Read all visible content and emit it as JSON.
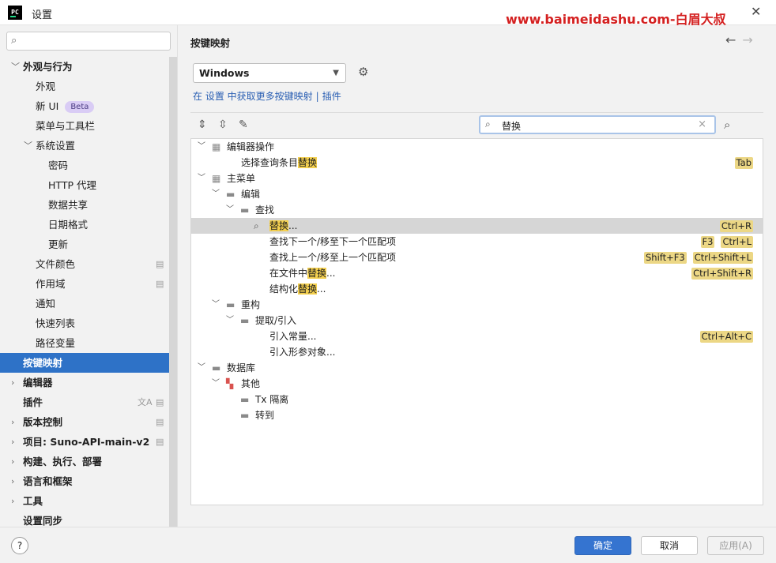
{
  "window": {
    "app_icon_text": "PC",
    "title": "设置",
    "watermark": "www.baimeidashu.com-白眉大叔"
  },
  "sidebar": {
    "search_placeholder": "",
    "items": [
      {
        "label": "外观与行为",
        "bold": true,
        "expanded": true
      },
      {
        "label": "外观"
      },
      {
        "label": "新 UI",
        "badge": "Beta"
      },
      {
        "label": "菜单与工具栏"
      },
      {
        "label": "系统设置",
        "expanded": true
      },
      {
        "label": "密码"
      },
      {
        "label": "HTTP 代理"
      },
      {
        "label": "数据共享"
      },
      {
        "label": "日期格式"
      },
      {
        "label": "更新"
      },
      {
        "label": "文件颜色"
      },
      {
        "label": "作用域"
      },
      {
        "label": "通知"
      },
      {
        "label": "快速列表"
      },
      {
        "label": "路径变量"
      },
      {
        "label": "按键映射",
        "bold": true,
        "selected": true
      },
      {
        "label": "编辑器",
        "bold": true
      },
      {
        "label": "插件",
        "bold": true
      },
      {
        "label": "版本控制",
        "bold": true
      },
      {
        "label": "项目: Suno-API-main-v2",
        "bold": true
      },
      {
        "label": "构建、执行、部署",
        "bold": true
      },
      {
        "label": "语言和框架",
        "bold": true
      },
      {
        "label": "工具",
        "bold": true
      },
      {
        "label": "设置同步",
        "bold": true
      }
    ]
  },
  "main": {
    "title": "按键映射",
    "keymap_value": "Windows",
    "links": {
      "prefix": "在 设置 中获取更多按键映射",
      "sep": "|",
      "plugins": "插件"
    },
    "filter_value": "替换",
    "tree": [
      {
        "label": "编辑器操作"
      },
      {
        "label_pre": "选择查询条目",
        "label_hl": "替换",
        "label_post": "",
        "shortcuts": [
          "Tab"
        ]
      },
      {
        "label": "主菜单"
      },
      {
        "label": "编辑"
      },
      {
        "label": "查找"
      },
      {
        "label_pre": "",
        "label_hl": "替换",
        "label_post": "...",
        "shortcuts": [
          "Ctrl+R"
        ]
      },
      {
        "label": "查找下一个/移至下一个匹配项",
        "shortcuts": [
          "F3",
          "Ctrl+L"
        ]
      },
      {
        "label": "查找上一个/移至上一个匹配项",
        "shortcuts": [
          "Shift+F3",
          "Ctrl+Shift+L"
        ]
      },
      {
        "label_pre": "在文件中",
        "label_hl": "替换",
        "label_post": "...",
        "shortcuts": [
          "Ctrl+Shift+R"
        ]
      },
      {
        "label_pre": "结构化",
        "label_hl": "替换",
        "label_post": "..."
      },
      {
        "label": "重构"
      },
      {
        "label": "提取/引入"
      },
      {
        "label": "引入常量...",
        "shortcuts": [
          "Ctrl+Alt+C"
        ]
      },
      {
        "label": "引入形参对象..."
      },
      {
        "label": "数据库"
      },
      {
        "label": "其他"
      },
      {
        "label": "Tx 隔离"
      },
      {
        "label": "转到"
      }
    ]
  },
  "footer": {
    "help": "?",
    "ok": "确定",
    "cancel": "取消",
    "apply": "应用(A)"
  },
  "colors": {
    "accent": "#2e72c7",
    "highlight": "#f4d04f",
    "shortcut_bg": "#ecd785"
  }
}
